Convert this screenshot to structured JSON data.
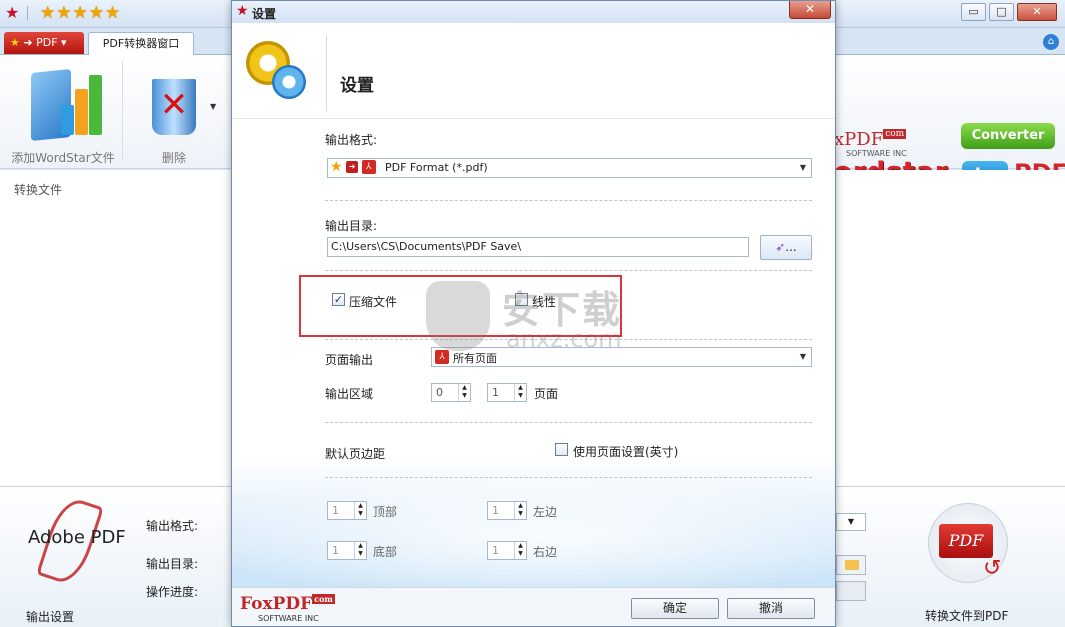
{
  "main": {
    "quick_access_stars": "★★★★★",
    "tab_label": "PDF转换器窗口",
    "ribbon": {
      "add_label": "添加WordStar文件",
      "delete_label": "删除"
    },
    "left_pane_label": "转换文件",
    "brand": {
      "top": "xPDF",
      "com_tag": "com",
      "inc": "SOFTWARE INC",
      "converter": "Converter",
      "word": "ordstar",
      "to": "to",
      "pdf": "PDF"
    },
    "bottom": {
      "adobe": "Adobe PDF",
      "output_format_label": "输出格式:",
      "output_dir_label": "输出目录:",
      "progress_label": "操作进度:",
      "output_settings_label": "输出设置",
      "convert_label": "转换文件到PDF",
      "convert_icon_text": "PDF"
    }
  },
  "dialog": {
    "title": "设置",
    "close": "✕",
    "header_title": "设置",
    "output_format": {
      "label": "输出格式:",
      "value": "PDF Format (*.pdf)"
    },
    "output_dir": {
      "label": "输出目录:",
      "value": "C:\\Users\\CS\\Documents\\PDF Save\\",
      "browse_label": "..."
    },
    "compress": {
      "label": "压缩文件",
      "checked": true
    },
    "linearize": {
      "label": "线性",
      "checked": false
    },
    "page_output": {
      "label": "页面输出",
      "value": "所有页面"
    },
    "output_range": {
      "label": "输出区域",
      "from": "0",
      "to": "1",
      "unit": "页面"
    },
    "default_margin": {
      "label": "默认页边距",
      "use_page_setting_label": "使用页面设置(英寸)",
      "use_page_setting_checked": false
    },
    "margins": {
      "top": {
        "value": "1",
        "label": "顶部"
      },
      "left": {
        "value": "1",
        "label": "左边"
      },
      "bottom": {
        "value": "1",
        "label": "底部"
      },
      "right": {
        "value": "1",
        "label": "右边"
      }
    },
    "ok": "确定",
    "cancel": "撤消",
    "footer_logo": {
      "name": "FoxPDF",
      "com": "com",
      "inc": "SOFTWARE INC"
    }
  },
  "watermark": {
    "cn": "安下载",
    "en": "anxz.com"
  },
  "colors": {
    "highlight": "#d9363e",
    "brand_red": "#c0282a",
    "titlebar": "#d2e1f3"
  }
}
